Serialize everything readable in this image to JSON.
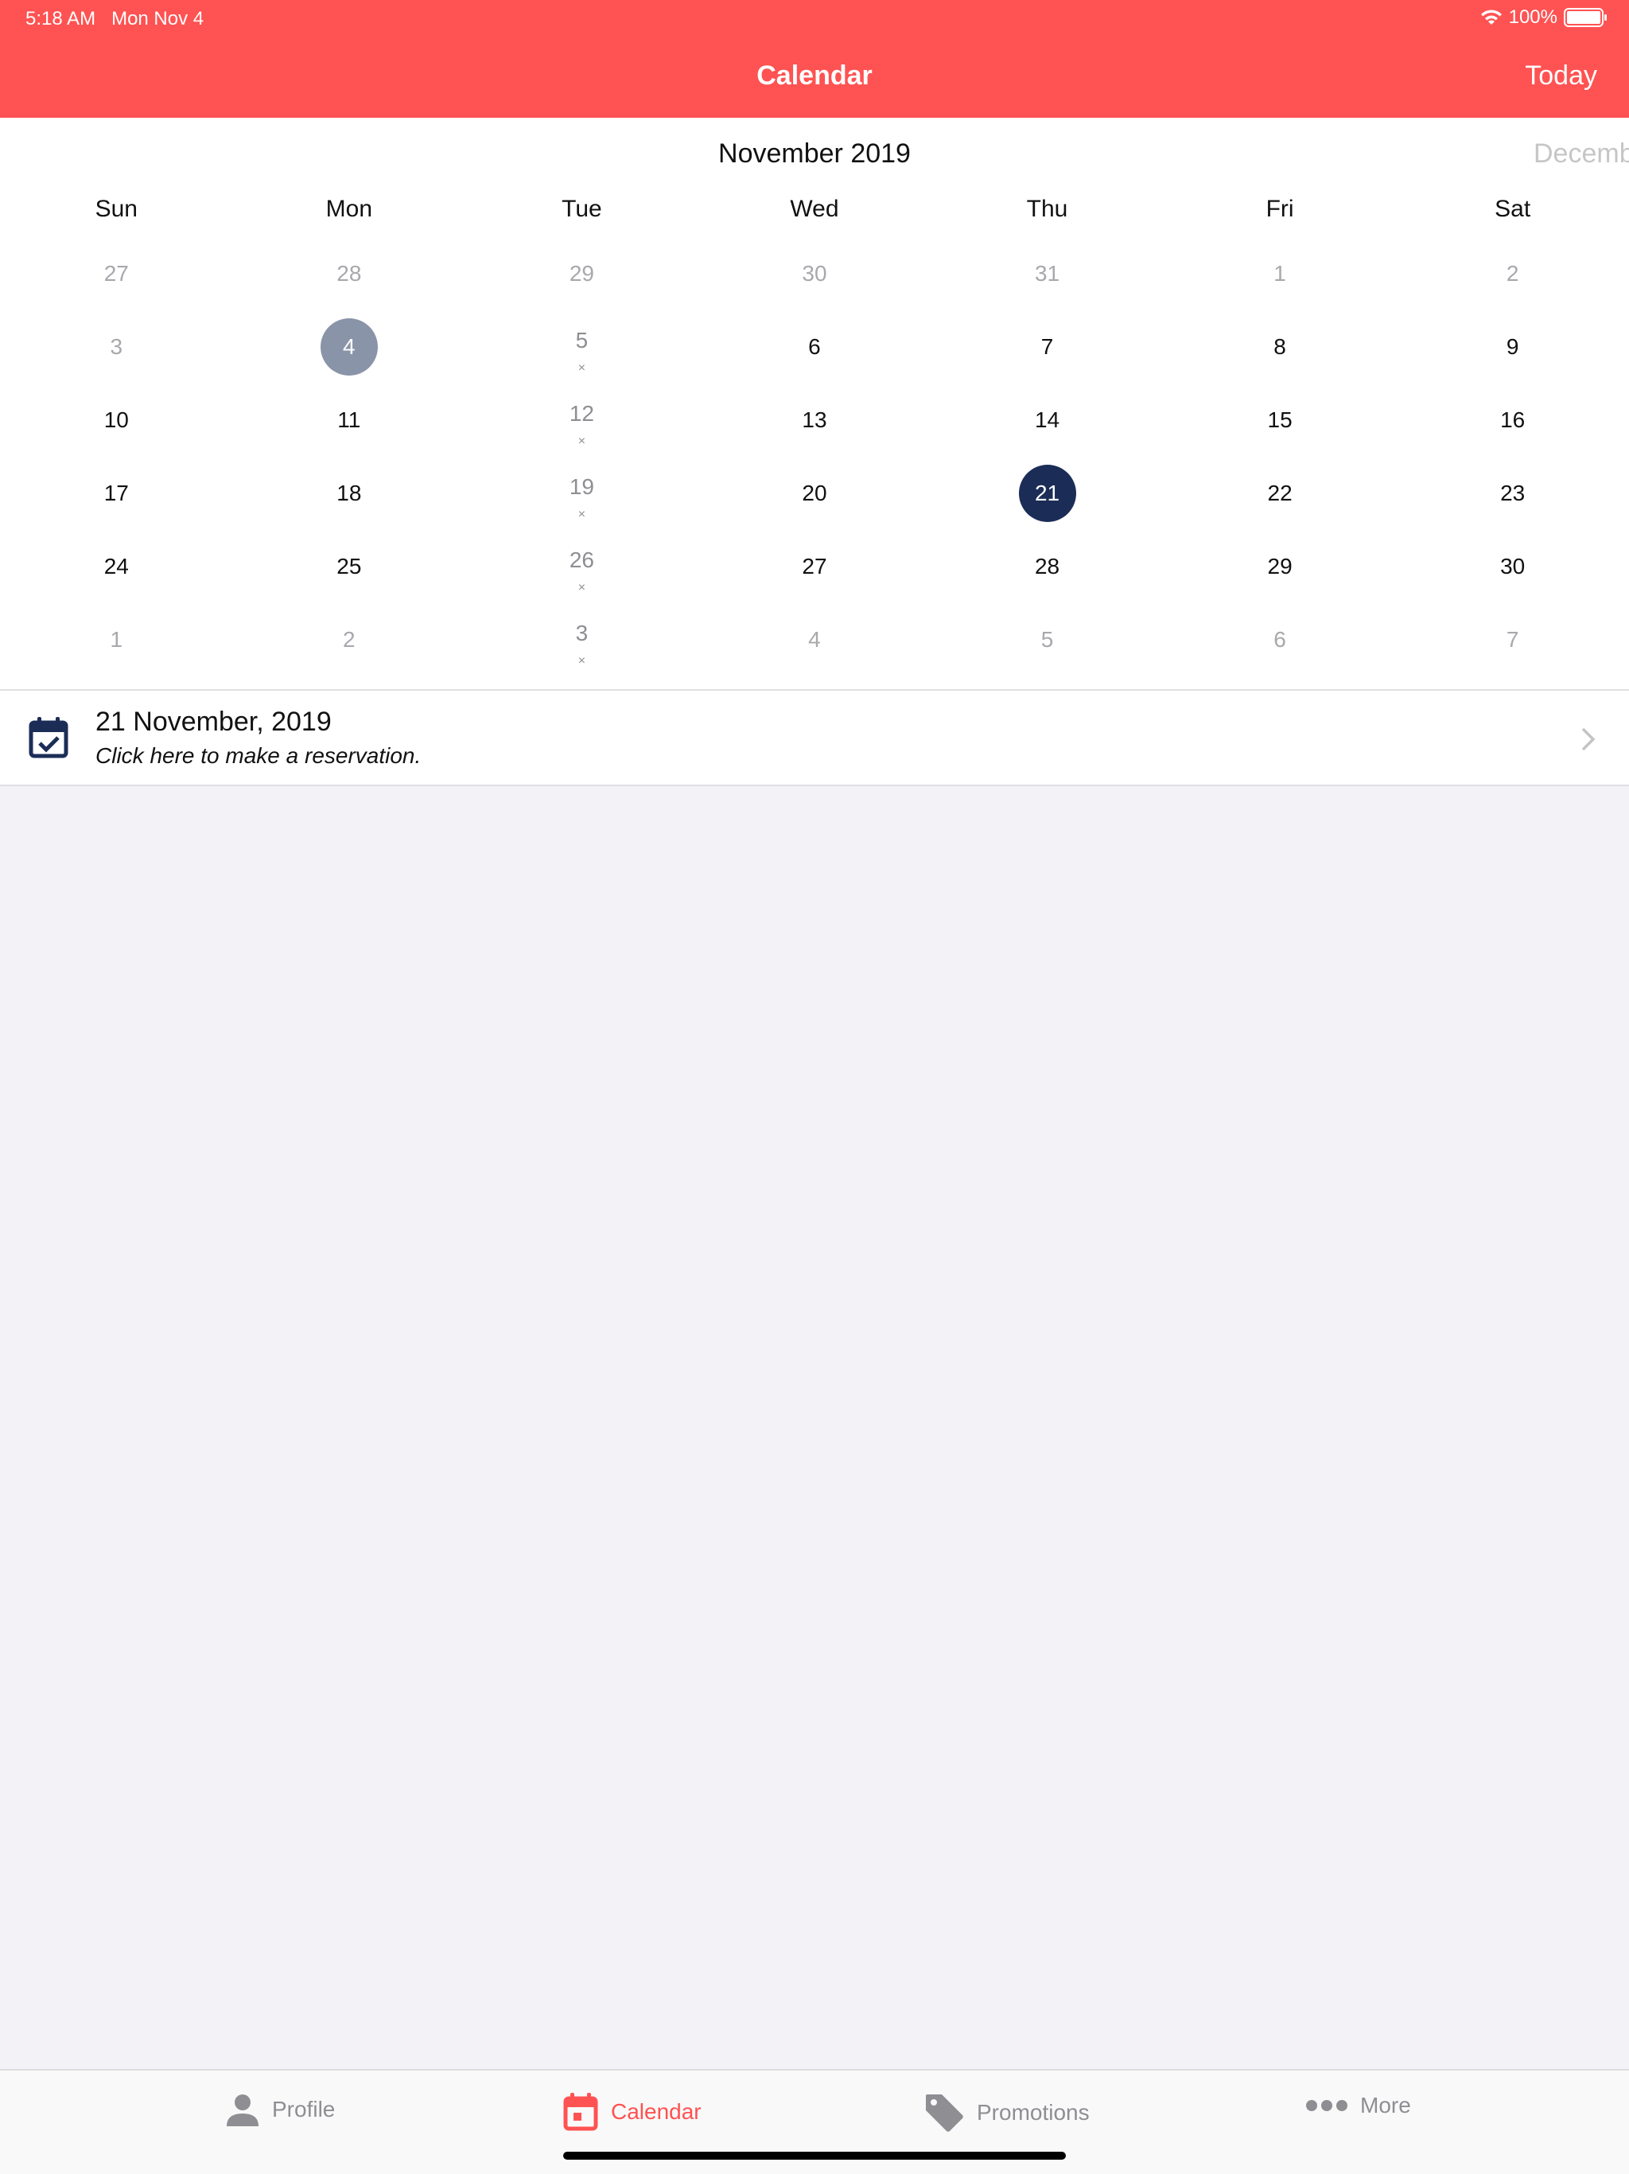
{
  "status_bar": {
    "time": "5:18 AM",
    "date": "Mon Nov 4",
    "battery": "100%",
    "battery_level": 1.0
  },
  "nav": {
    "title": "Calendar",
    "today_label": "Today"
  },
  "calendar": {
    "month_title": "November 2019",
    "next_month_peek": "December",
    "weekdays": [
      "Sun",
      "Mon",
      "Tue",
      "Wed",
      "Thu",
      "Fri",
      "Sat"
    ],
    "weeks": [
      [
        {
          "n": "27",
          "s": "other"
        },
        {
          "n": "28",
          "s": "other"
        },
        {
          "n": "29",
          "s": "other"
        },
        {
          "n": "30",
          "s": "other"
        },
        {
          "n": "31",
          "s": "other"
        },
        {
          "n": "1",
          "s": "other"
        },
        {
          "n": "2",
          "s": "other"
        }
      ],
      [
        {
          "n": "3",
          "s": "other"
        },
        {
          "n": "4",
          "s": "today"
        },
        {
          "n": "5",
          "s": "mark"
        },
        {
          "n": "6",
          "s": ""
        },
        {
          "n": "7",
          "s": ""
        },
        {
          "n": "8",
          "s": ""
        },
        {
          "n": "9",
          "s": ""
        }
      ],
      [
        {
          "n": "10",
          "s": ""
        },
        {
          "n": "11",
          "s": ""
        },
        {
          "n": "12",
          "s": "mark"
        },
        {
          "n": "13",
          "s": ""
        },
        {
          "n": "14",
          "s": ""
        },
        {
          "n": "15",
          "s": ""
        },
        {
          "n": "16",
          "s": ""
        }
      ],
      [
        {
          "n": "17",
          "s": ""
        },
        {
          "n": "18",
          "s": ""
        },
        {
          "n": "19",
          "s": "mark"
        },
        {
          "n": "20",
          "s": ""
        },
        {
          "n": "21",
          "s": "selected"
        },
        {
          "n": "22",
          "s": ""
        },
        {
          "n": "23",
          "s": ""
        }
      ],
      [
        {
          "n": "24",
          "s": ""
        },
        {
          "n": "25",
          "s": ""
        },
        {
          "n": "26",
          "s": "mark"
        },
        {
          "n": "27",
          "s": ""
        },
        {
          "n": "28",
          "s": ""
        },
        {
          "n": "29",
          "s": ""
        },
        {
          "n": "30",
          "s": ""
        }
      ],
      [
        {
          "n": "1",
          "s": "other"
        },
        {
          "n": "2",
          "s": "other"
        },
        {
          "n": "3",
          "s": "mark"
        },
        {
          "n": "4",
          "s": "other"
        },
        {
          "n": "5",
          "s": "other"
        },
        {
          "n": "6",
          "s": "other"
        },
        {
          "n": "7",
          "s": "other"
        }
      ]
    ],
    "mark_symbol": "×"
  },
  "reservation": {
    "date": "21 November, 2019",
    "hint": "Click here to make a reservation.",
    "icon": "calendar-check-icon"
  },
  "tabs": [
    {
      "label": "Profile",
      "icon": "person-icon",
      "active": false
    },
    {
      "label": "Calendar",
      "icon": "calendar-icon",
      "active": true
    },
    {
      "label": "Promotions",
      "icon": "tag-icon",
      "active": false
    },
    {
      "label": "More",
      "icon": "ellipsis-icon",
      "active": false
    }
  ],
  "colors": {
    "accent": "#ff5252",
    "selected": "#1b2d57",
    "today": "#8a94a8",
    "inactive": "#8e8e93"
  }
}
